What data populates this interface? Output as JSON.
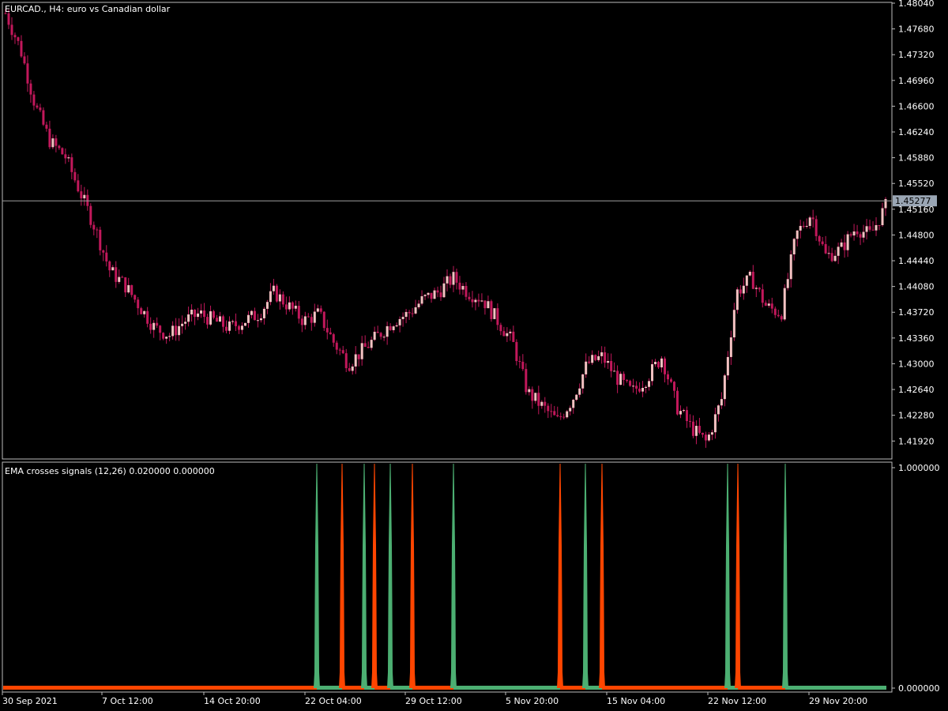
{
  "main_panel": {
    "title": "EURCAD., H4:  euro vs Canadian dollar",
    "current_price": "1.45277",
    "current_price_value": 1.45277,
    "price_axis_labels": [
      "1.48040",
      "1.47680",
      "1.47320",
      "1.46960",
      "1.46600",
      "1.46240",
      "1.45880",
      "1.45520",
      "1.45160",
      "1.44800",
      "1.44440",
      "1.44080",
      "1.43720",
      "1.43360",
      "1.43000",
      "1.42640",
      "1.42280",
      "1.41920"
    ],
    "price_range": [
      1.4168,
      1.4804
    ],
    "candle_color": "#c2185b",
    "candle_color_light": "#f4c2c2"
  },
  "indicator_panel": {
    "title": "EMA crosses signals (12,26) 0.020000 0.000000",
    "axis_labels": [
      "1.000000",
      "0.000000"
    ],
    "buy_color": "#4caf72",
    "sell_color": "#ff4500",
    "signals": [
      {
        "type": "buy",
        "bar": 401
      },
      {
        "type": "sell",
        "bar": 433
      },
      {
        "type": "buy",
        "bar": 461
      },
      {
        "type": "sell",
        "bar": 474
      },
      {
        "type": "buy",
        "bar": 494
      },
      {
        "type": "sell",
        "bar": 522
      },
      {
        "type": "buy",
        "bar": 574
      },
      {
        "type": "sell",
        "bar": 709
      },
      {
        "type": "buy",
        "bar": 741
      },
      {
        "type": "sell",
        "bar": 762
      },
      {
        "type": "buy",
        "bar": 921
      },
      {
        "type": "sell",
        "bar": 934
      },
      {
        "type": "buy",
        "bar": 994
      }
    ]
  },
  "time_axis_labels": [
    "30 Sep 2021",
    "7 Oct 12:00",
    "14 Oct 20:00",
    "22 Oct 04:00",
    "29 Oct 12:00",
    "5 Nov 20:00",
    "15 Nov 04:00",
    "22 Nov 12:00",
    "29 Nov 20:00"
  ],
  "chart_data": {
    "type": "candlestick",
    "title": "EURCAD., H4:  euro vs Canadian dollar",
    "x": [
      "30 Sep 2021",
      "7 Oct 12:00",
      "14 Oct 20:00",
      "22 Oct 04:00",
      "29 Oct 12:00",
      "5 Nov 20:00",
      "15 Nov 04:00",
      "22 Nov 12:00",
      "29 Nov 20:00"
    ],
    "close_path": [
      1.479,
      1.474,
      1.466,
      1.461,
      1.459,
      1.454,
      1.449,
      1.443,
      1.441,
      1.438,
      1.435,
      1.434,
      1.436,
      1.437,
      1.436,
      1.435,
      1.436,
      1.437,
      1.44,
      1.438,
      1.436,
      1.437,
      1.433,
      1.43,
      1.432,
      1.434,
      1.436,
      1.437,
      1.439,
      1.44,
      1.442,
      1.44,
      1.439,
      1.436,
      1.433,
      1.426,
      1.424,
      1.422,
      1.425,
      1.43,
      1.431,
      1.428,
      1.426,
      1.428,
      1.431,
      1.424,
      1.421,
      1.419,
      1.425,
      1.44,
      1.442,
      1.438,
      1.437,
      1.448,
      1.451,
      1.445,
      1.446,
      1.449,
      1.448,
      1.452
    ],
    "ylim": [
      1.4168,
      1.4804
    ]
  }
}
